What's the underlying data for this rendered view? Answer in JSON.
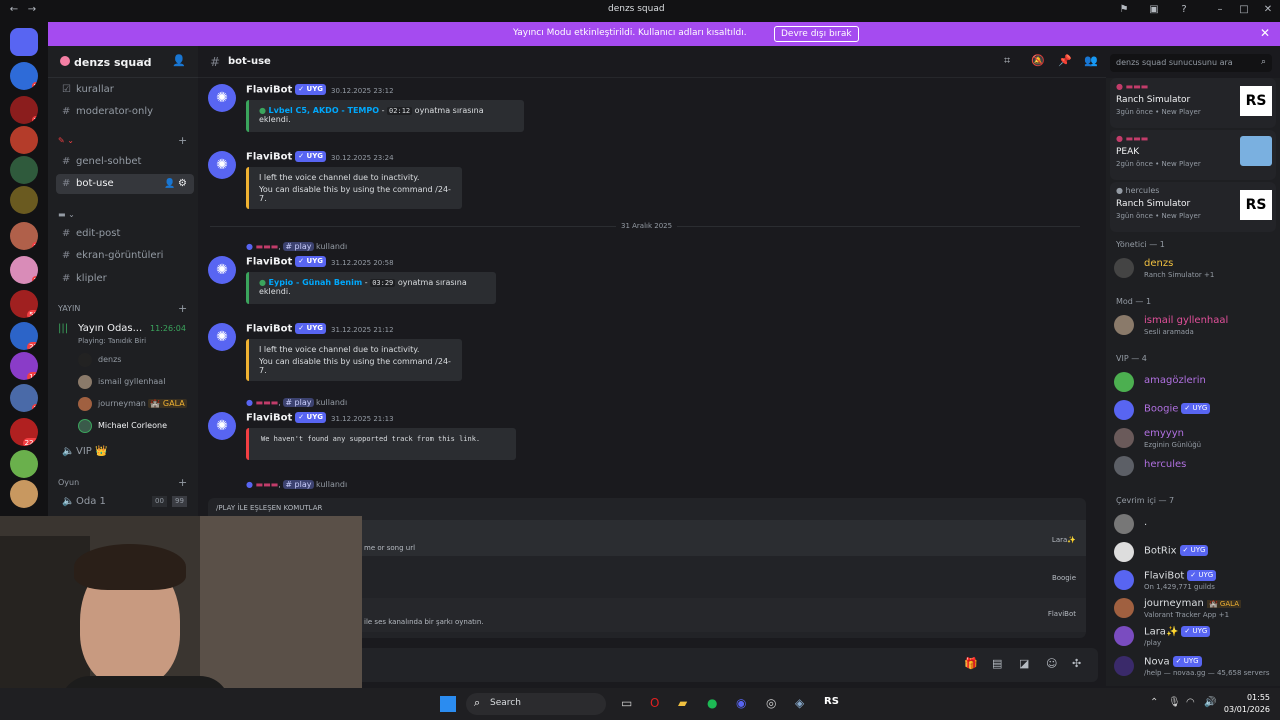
{
  "window": {
    "title": "denzs squad"
  },
  "banner": {
    "message": "Yayıncı Modu etkinleştirildi. Kullanıcı adları kısaltıldı.",
    "button": "Devre dışı bırak"
  },
  "server": {
    "name": "denzs squad"
  },
  "channels": {
    "top": [
      {
        "label": "kurallar"
      },
      {
        "label": "moderator-only"
      }
    ],
    "text": [
      {
        "label": "genel-sohbet"
      },
      {
        "label": "bot-use"
      },
      {
        "label": "edit-post"
      },
      {
        "label": "ekran-görüntüleri"
      },
      {
        "label": "klipler"
      }
    ],
    "yayin_category": "YAYIN",
    "voice_channel": {
      "label": "Yayın Odas...",
      "time": "11:26:04",
      "status": "Playing: Tanıdık Biri"
    },
    "voice_users": [
      {
        "name": "denzs"
      },
      {
        "name": "ismail gyllenhaal"
      },
      {
        "name": "journeyman",
        "tag": "GALA"
      },
      {
        "name": "Michael Corleone"
      }
    ],
    "vip": "VIP 👑",
    "oyun_category": "Oyun",
    "oda": {
      "label": "Oda 1",
      "a": "00",
      "b": "99"
    }
  },
  "header": {
    "channel": "bot-use",
    "search_placeholder": "denzs squad sunucusunu ara"
  },
  "messages": [
    {
      "author": "FlaviBot",
      "tag": "✓ UYG",
      "time": "30.12.2025 23:12",
      "track": "Lvbel C5, AKDO - TEMPO",
      "duration": "02:12",
      "suffix": "oynatma sırasına eklendi."
    },
    {
      "author": "FlaviBot",
      "tag": "✓ UYG",
      "time": "30.12.2025 23:24",
      "line1": "I left the voice channel due to inactivity.",
      "line2": "You can disable this by using the command /24-7."
    },
    {
      "divider": "31 Aralık 2025"
    },
    {
      "reply_cmd": "# play",
      "reply_tail": "kullandı",
      "author": "FlaviBot",
      "tag": "✓ UYG",
      "time": "31.12.2025 20:58",
      "track": "Eypio - Günah Benim",
      "duration": "03:29",
      "suffix": "oynatma sırasına eklendi."
    },
    {
      "author": "FlaviBot",
      "tag": "✓ UYG",
      "time": "31.12.2025 21:12",
      "line1": "I left the voice channel due to inactivity.",
      "line2": "You can disable this by using the command /24-7."
    },
    {
      "reply_cmd": "# play",
      "reply_tail": "kullandı",
      "author": "FlaviBot",
      "tag": "✓ UYG",
      "time": "31.12.2025 21:13",
      "error": "We haven't found any supported track from this link."
    },
    {
      "reply_cmd": "# play",
      "reply_tail": "kullandı"
    }
  ],
  "autocomplete": {
    "header": "/PLAY İLE EŞLEŞEN KOMUTLAR",
    "items": [
      {
        "desc": "me or song url",
        "source": "Lara✨"
      },
      {
        "desc": "",
        "source": "Boogie"
      },
      {
        "desc": "ile ses kanalında bir şarkı oynatın.",
        "source": "FlaviBot"
      }
    ]
  },
  "activities": [
    {
      "game": "Ranch Simulator",
      "meta": "3gün önce • New Player"
    },
    {
      "game": "PEAK",
      "meta": "2gün önce • New Player"
    },
    {
      "user": "hercules",
      "game": "Ranch Simulator",
      "meta": "3gün önce • New Player"
    }
  ],
  "members": {
    "yonetici": "Yönetici — 1",
    "yonetici_list": [
      {
        "name": "denzs",
        "status": "Ranch Simulator +1"
      }
    ],
    "mod": "Mod — 1",
    "mod_list": [
      {
        "name": "ismail gyllenhaal",
        "status": "Sesli aramada"
      }
    ],
    "vip": "VIP — 4",
    "vip_list": [
      {
        "name": "amagözlerin",
        "status": ""
      },
      {
        "name": "Boogie",
        "status": ""
      },
      {
        "name": "emyyyn",
        "status": "Ezginin Günlüğü"
      },
      {
        "name": "hercules",
        "status": ""
      }
    ],
    "online": "Çevrim içi — 7",
    "online_list": [
      {
        "name": ".",
        "status": ""
      },
      {
        "name": "BotRix",
        "status": ""
      },
      {
        "name": "FlaviBot",
        "status": "On 1,429,771 guilds"
      },
      {
        "name": "journeyman",
        "status": "Valorant Tracker App +1"
      },
      {
        "name": "Lara✨",
        "status": "/play"
      },
      {
        "name": "Nova",
        "status": "/help — novaa.gg — 45,658 servers"
      }
    ]
  },
  "taskbar": {
    "search": "Search",
    "time": "01:55",
    "date": "03/01/2026"
  },
  "colors": {
    "banner": "#a54bf0",
    "blurple": "#5865f2",
    "background": "#1a1a1e"
  }
}
